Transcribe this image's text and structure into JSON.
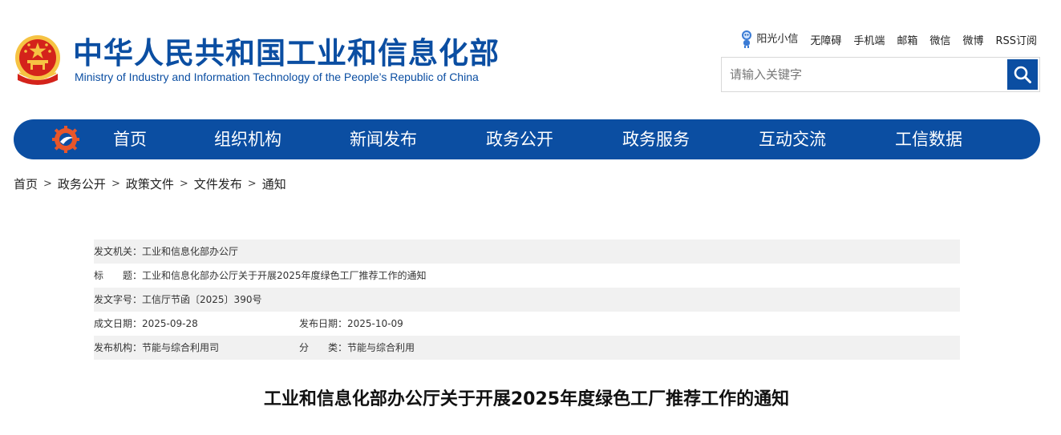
{
  "header": {
    "title_cn": "中华人民共和国工业和信息化部",
    "title_en": "Ministry of Industry and Information Technology of the People’s Republic of China",
    "top_links": [
      "阳光小信",
      "无障碍",
      "手机端",
      "邮箱",
      "微信",
      "微博",
      "RSS订阅"
    ],
    "search_placeholder": "请输入关键字"
  },
  "nav": {
    "items": [
      "首页",
      "组织机构",
      "新闻发布",
      "政务公开",
      "政务服务",
      "互动交流",
      "工信数据"
    ]
  },
  "breadcrumb": [
    "首页",
    "政务公开",
    "政策文件",
    "文件发布",
    "通知"
  ],
  "breadcrumb_sep": ">",
  "meta": {
    "issuer_label": "发文机关：",
    "issuer": "工业和信息化部办公厅",
    "title_label": "标　　题：",
    "title": "工业和信息化部办公厅关于开展2025年度绿色工厂推荐工作的通知",
    "doc_no_label": "发文字号：",
    "doc_no": "工信厅节函〔2025〕390号",
    "date_made_label": "成文日期：",
    "date_made": "2025-09-28",
    "date_pub_label": "发布日期：",
    "date_pub": "2025-10-09",
    "org_label": "发布机构：",
    "org": "节能与综合利用司",
    "category_label": "分　　类：",
    "category": "节能与综合利用"
  },
  "article": {
    "title": "工业和信息化部办公厅关于开展2025年度绿色工厂推荐工作的通知"
  },
  "colors": {
    "brand_blue": "#0b4ea2",
    "emblem_red": "#d4231b",
    "emblem_gold": "#f6c343"
  }
}
